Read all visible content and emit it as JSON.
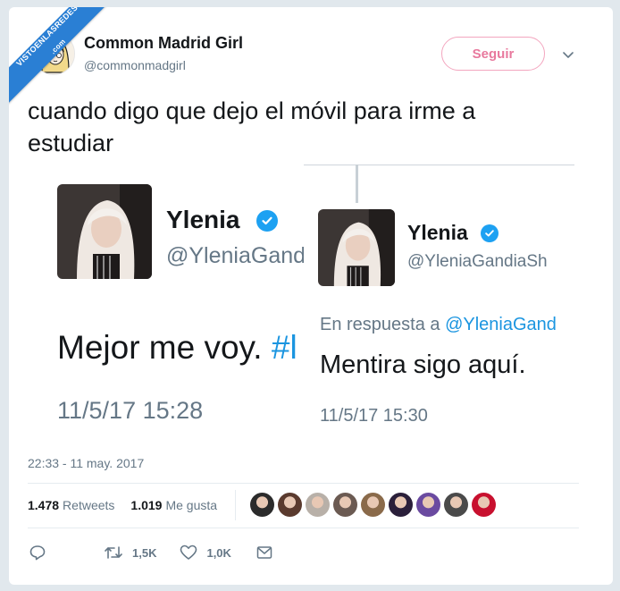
{
  "watermark": {
    "text": "VISTOENLASREDES",
    "sub": ".com"
  },
  "author": {
    "name": "Common Madrid Girl",
    "handle": "@commonmadgirl"
  },
  "follow_label": "Seguir",
  "tweet_text": "cuando digo que dejo el móvil para irme a estudiar",
  "screenshot_left": {
    "name": "Ylenia",
    "handle": "@YleniaGand",
    "text_before": "Mejor me voy. ",
    "hashtag": "#l",
    "date": "11/5/17 15:28"
  },
  "screenshot_right": {
    "name": "Ylenia",
    "handle": "@YleniaGandiaSh",
    "reply_prefix": "En respuesta a ",
    "reply_mention": "@YleniaGand",
    "text": "Mentira sigo aquí.",
    "date": "11/5/17 15:30"
  },
  "timestamp": "22:33 - 11 may. 2017",
  "stats": {
    "retweets_count": "1.478",
    "retweets_label": "Retweets",
    "likes_count": "1.019",
    "likes_label": "Me gusta"
  },
  "liker_avatar_colors": [
    "#2b2b2b",
    "#5a3a2e",
    "#b8b0a8",
    "#6b5a52",
    "#8a6a4a",
    "#2a1f3a",
    "#6a4aa0",
    "#4a4a4a",
    "#c8102e"
  ],
  "actions": {
    "reply_icon": "reply-icon",
    "retweet_count": "1,5K",
    "like_count": "1,0K",
    "message_icon": "envelope-icon"
  },
  "colors": {
    "accent": "#1da1f2",
    "follow": "#e8789d",
    "muted": "#657786"
  }
}
